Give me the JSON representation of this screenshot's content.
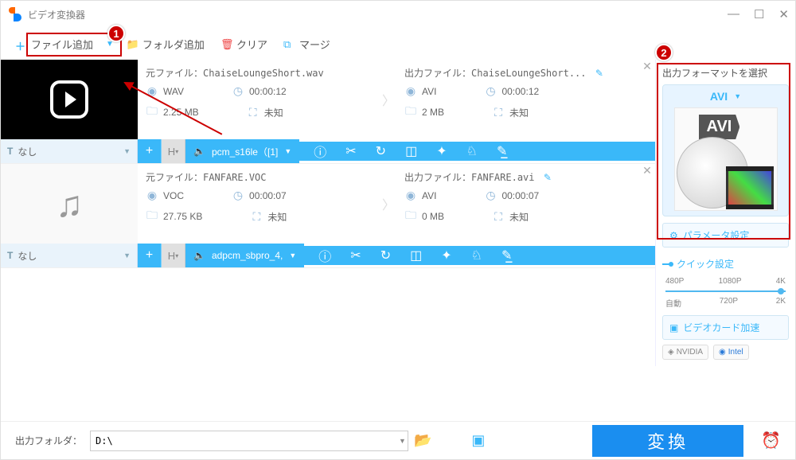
{
  "window": {
    "title": "ビデオ変換器"
  },
  "toolbar": {
    "add_file": "ファイル追加",
    "add_folder": "フォルダ追加",
    "clear": "クリア",
    "merge": "マージ"
  },
  "files": [
    {
      "source": {
        "label": "元ファイル：",
        "name": "ChaiseLoungeShort.wav",
        "format": "WAV",
        "duration": "00:00:12",
        "size": "2.25 MB",
        "dim": "未知"
      },
      "output": {
        "label": "出力ファイル：",
        "name": "ChaiseLoungeShort...",
        "format": "AVI",
        "duration": "00:00:12",
        "size": "2 MB",
        "dim": "未知"
      },
      "sub": "なし",
      "codec": "pcm_s16le（[1]"
    },
    {
      "source": {
        "label": "元ファイル：",
        "name": "FANFARE.VOC",
        "format": "VOC",
        "duration": "00:00:07",
        "size": "27.75 KB",
        "dim": "未知"
      },
      "output": {
        "label": "出力ファイル：",
        "name": "FANFARE.avi",
        "format": "AVI",
        "duration": "00:00:07",
        "size": "0 MB",
        "dim": "未知"
      },
      "sub": "なし",
      "codec": "adpcm_sbpro_4,"
    }
  ],
  "sidebar": {
    "title": "出力フォーマットを選択",
    "format": "AVI",
    "format_badge": "AVI",
    "params": "パラメータ設定",
    "quick": "クイック設定",
    "presets": {
      "r1": [
        "480P",
        "1080P",
        "4K"
      ],
      "r2": [
        "自動",
        "720P",
        "2K"
      ]
    },
    "gpu": "ビデオカード加速",
    "nvidia": "NVIDIA",
    "intel": "Intel"
  },
  "footer": {
    "label": "出力フォルダ：",
    "path": "D:\\",
    "convert": "変換"
  },
  "annot": {
    "b1": "1",
    "b2": "2"
  }
}
